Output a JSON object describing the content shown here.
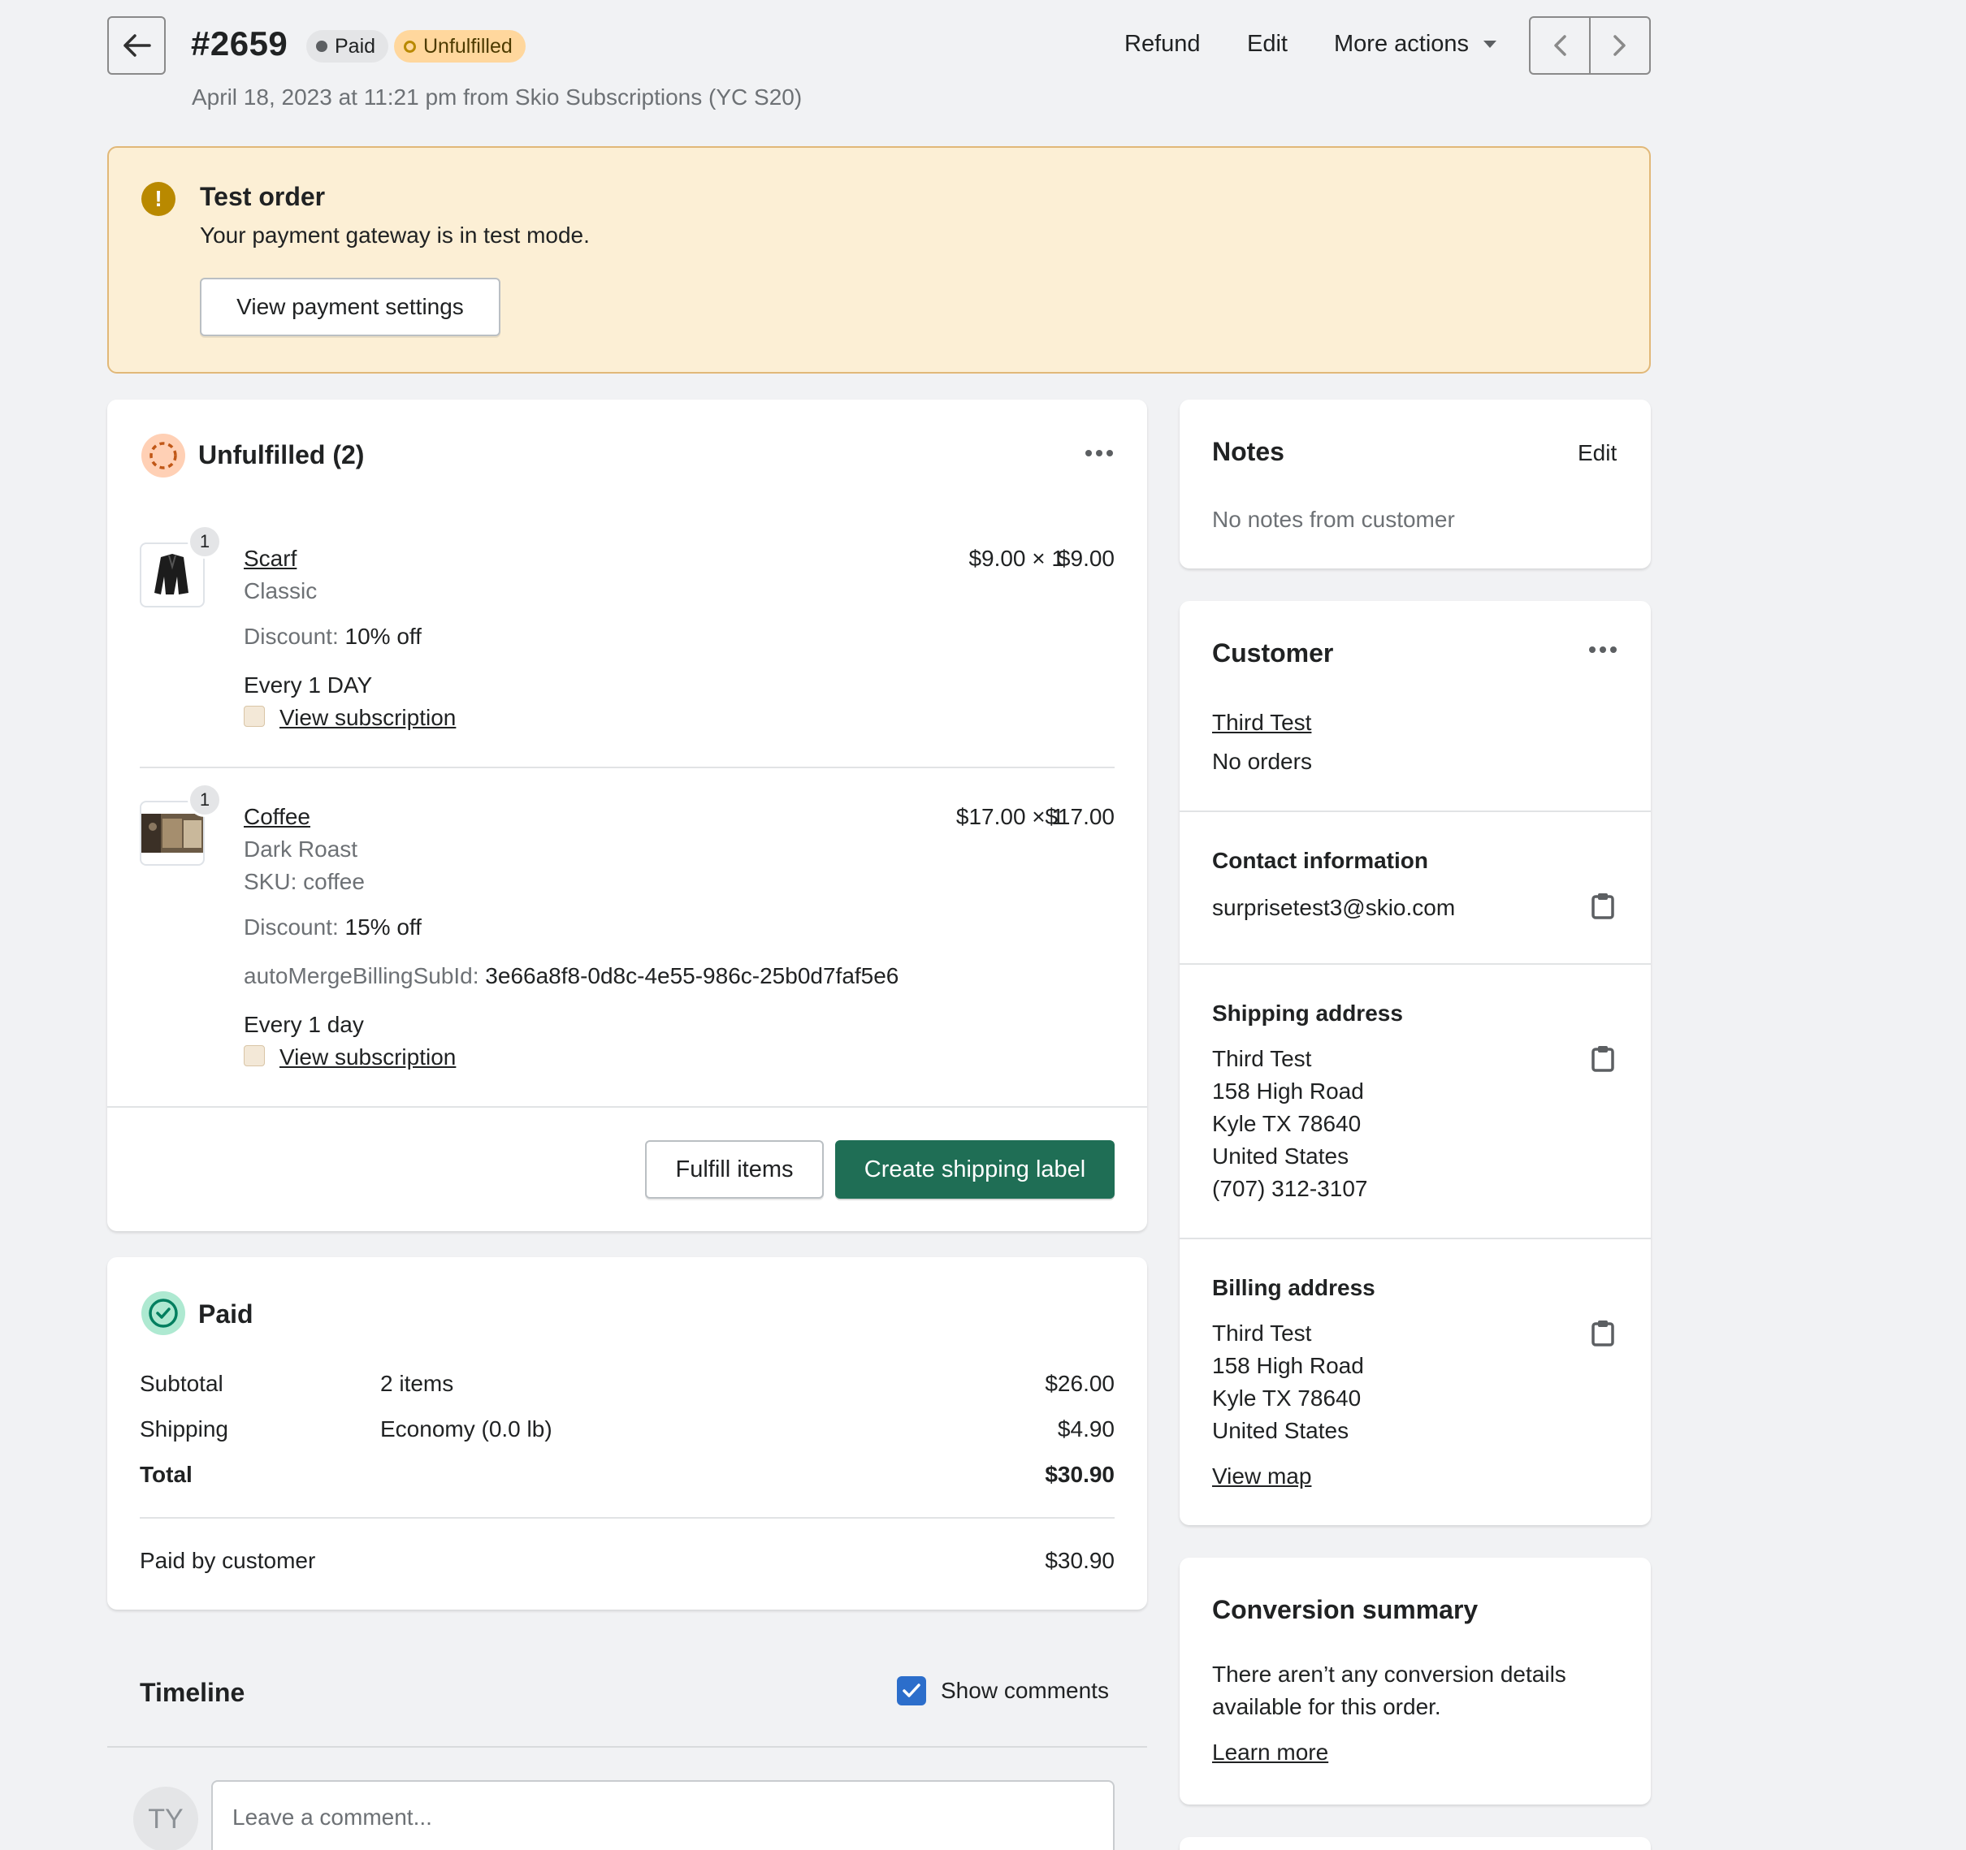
{
  "header": {
    "order_number": "#2659",
    "badge_paid": "Paid",
    "badge_unfulfilled": "Unfulfilled",
    "refund_label": "Refund",
    "edit_label": "Edit",
    "more_actions_label": "More actions",
    "subtitle": "April 18, 2023 at 11:21 pm from Skio Subscriptions (YC S20)"
  },
  "banner": {
    "title": "Test order",
    "text": "Your payment gateway is in test mode.",
    "button": "View payment settings"
  },
  "unfulfilled": {
    "title": "Unfulfilled (2)",
    "items": [
      {
        "qty": "1",
        "name": "Scarf",
        "variant": "Classic",
        "price": "$9.00 × 1",
        "total": "$9.00",
        "discount_label": "Discount:",
        "discount_value": "10% off",
        "frequency": "Every 1 DAY",
        "subscription_link": "View subscription"
      },
      {
        "qty": "1",
        "name": "Coffee",
        "variant": "Dark Roast",
        "sku": "SKU: coffee",
        "price": "$17.00 × 1",
        "total": "$17.00",
        "discount_label": "Discount:",
        "discount_value": "15% off",
        "attr_label": "autoMergeBillingSubId:",
        "attr_value": "3e66a8f8-0d8c-4e55-986c-25b0d7faf5e6",
        "frequency": "Every 1 day",
        "subscription_link": "View subscription"
      }
    ],
    "fulfill_button": "Fulfill items",
    "shipping_label_button": "Create shipping label"
  },
  "paid": {
    "title": "Paid",
    "rows": [
      {
        "label": "Subtotal",
        "desc": "2 items",
        "amount": "$26.00"
      },
      {
        "label": "Shipping",
        "desc": "Economy (0.0 lb)",
        "amount": "$4.90"
      },
      {
        "label": "Total",
        "desc": "",
        "amount": "$30.90"
      }
    ],
    "paid_by_label": "Paid by customer",
    "paid_by_amount": "$30.90"
  },
  "timeline": {
    "title": "Timeline",
    "show_comments": "Show comments",
    "avatar": "TY",
    "comment_placeholder": "Leave a comment..."
  },
  "notes": {
    "title": "Notes",
    "edit": "Edit",
    "text": "No notes from customer"
  },
  "customer": {
    "title": "Customer",
    "name": "Third Test",
    "orders": "No orders",
    "contact_title": "Contact information",
    "email": "surprisetest3@skio.com",
    "shipping_title": "Shipping address",
    "shipping_lines": [
      "Third Test",
      "158 High Road",
      "Kyle TX 78640",
      "United States",
      "(707) 312-3107"
    ],
    "billing_title": "Billing address",
    "billing_lines": [
      "Third Test",
      "158 High Road",
      "Kyle TX 78640",
      "United States"
    ],
    "view_map": "View map"
  },
  "conversion": {
    "title": "Conversion summary",
    "text_line1": "There aren’t any conversion details",
    "text_line2": "available for this order.",
    "learn_more": "Learn more"
  },
  "colors": {
    "primary_green": "#1f6e55",
    "link_blue": "#2c6ecb",
    "banner_bg": "#fcefd5",
    "unfulfilled_badge": "#ffd79d"
  }
}
